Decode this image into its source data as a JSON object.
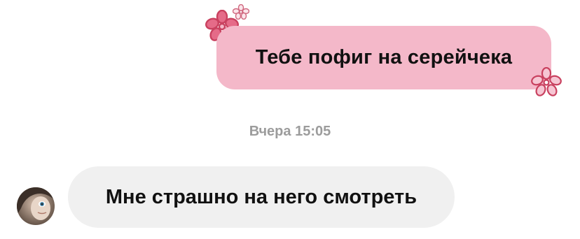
{
  "messages": {
    "outgoing": {
      "text": "Тебе пофиг на серейчека",
      "bubble_color": "#f4b8c9"
    },
    "timestamp": "Вчера 15:05",
    "incoming": {
      "text": "Мне страшно на него смотреть",
      "bubble_color": "#f0f0f0"
    }
  },
  "decorations": {
    "flower_color": "#c9415f",
    "icons": [
      "flower-icon",
      "flower-icon",
      "flower-icon"
    ]
  },
  "avatar": {
    "icon": "avatar"
  }
}
